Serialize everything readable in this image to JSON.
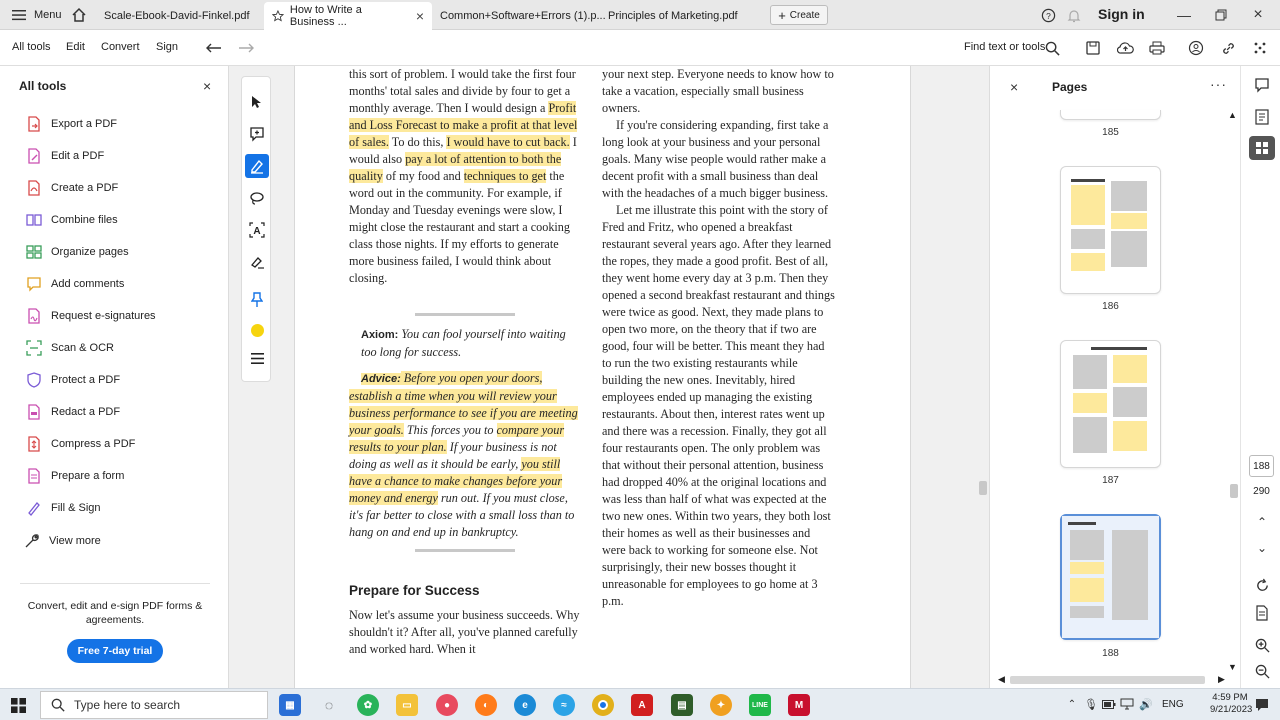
{
  "tabbar": {
    "menu_label": "Menu",
    "tabs": [
      {
        "label": "Scale-Ebook-David-Finkel.pdf"
      },
      {
        "label": "How to Write a Business ...",
        "active": true
      },
      {
        "label": "Common+Software+Errors (1).p..."
      },
      {
        "label": "Principles of Marketing.pdf"
      }
    ],
    "create_label": "Create",
    "signin_label": "Sign in"
  },
  "toolbar": {
    "items": [
      "All tools",
      "Edit",
      "Convert",
      "Sign"
    ],
    "find_label": "Find text or tools"
  },
  "left_panel": {
    "title": "All tools",
    "tools": [
      {
        "label": "Export a PDF",
        "color": "#d84a4a"
      },
      {
        "label": "Edit a PDF",
        "color": "#c94fb0"
      },
      {
        "label": "Create a PDF",
        "color": "#d84a4a"
      },
      {
        "label": "Combine files",
        "color": "#7b5cd6"
      },
      {
        "label": "Organize pages",
        "color": "#3a9e5a"
      },
      {
        "label": "Add comments",
        "color": "#e0a020"
      },
      {
        "label": "Request e-signatures",
        "color": "#c94fb0"
      },
      {
        "label": "Scan & OCR",
        "color": "#3a9e5a"
      },
      {
        "label": "Protect a PDF",
        "color": "#7b5cd6"
      },
      {
        "label": "Redact a PDF",
        "color": "#c94fb0"
      },
      {
        "label": "Compress a PDF",
        "color": "#d84a4a"
      },
      {
        "label": "Prepare a form",
        "color": "#c94fb0"
      },
      {
        "label": "Fill & Sign",
        "color": "#7b5cd6"
      },
      {
        "label": "View more",
        "color": "#333333"
      }
    ],
    "promo_text": "Convert, edit and e-sign PDF forms & agreements.",
    "trial_button": "Free 7-day trial"
  },
  "document": {
    "left_column": {
      "p1": [
        {
          "t": "this sort of problem. I would take the first four months' total sales and divide by four to get a monthly average. Then I would design a ",
          "h": false
        },
        {
          "t": "Profit and Loss Forecast to make a profit at that level of sales.",
          "h": true
        },
        {
          "t": " To do this, ",
          "h": false
        },
        {
          "t": "I would have to cut back.",
          "h": true
        },
        {
          "t": " I would also ",
          "h": false
        },
        {
          "t": "pay a lot of attention to both the quality",
          "h": true
        },
        {
          "t": " of my food and ",
          "h": false
        },
        {
          "t": "techniques to get",
          "h": true
        },
        {
          "t": " the word out in the community. For example, if Monday and Tuesday evenings were slow, I might close the restaurant and start a cooking class those nights. If my efforts to generate more business failed, I would think about closing.",
          "h": false
        }
      ],
      "axiom_label": "Axiom:",
      "axiom_text": " You can fool yourself into waiting too long for success.",
      "advice": [
        {
          "t": "Advice:",
          "h": true,
          "b": true
        },
        {
          "t": " Before you open your doors, establish a time when you will review your business performance to see if you are meeting your goals.",
          "h": true
        },
        {
          "t": " This forces you to ",
          "h": false
        },
        {
          "t": "compare your results to your plan.",
          "h": true
        },
        {
          "t": " If your business is not doing as well as it should be early, ",
          "h": false
        },
        {
          "t": "you still have a chance to make changes before your money and energy",
          "h": true
        },
        {
          "t": " run out. If you must close, it's far better to close with a small loss than to hang on and end up in bankruptcy.",
          "h": false
        }
      ],
      "heading": "Prepare for Success",
      "p_final": "Now let's assume your business succeeds. Why shouldn't it? After all, you've planned carefully and worked hard. When it"
    },
    "right_column": {
      "p1": "your next step. Everyone needs to know how to take a vacation, especially small business owners.",
      "p2": "If you're considering expanding, first take a long look at your business and your personal goals. Many wise people would rather make a decent profit with a small business than deal with the headaches of a much bigger business.",
      "p3": "Let me illustrate this point with the story of Fred and Fritz, who opened a breakfast restaurant several years ago. After they learned the ropes, they made a good profit. Best of all, they went home every day at 3 p.m. Then they opened a second breakfast restaurant and things were twice as good. Next, they made plans to open two more, on the theory that if two are good, four will be better. This meant they had to run the two existing restaurants while building the new ones. Inevitably, hired employees ended up managing the existing restaurants. About then, interest rates went up and there was a recession. Finally, they got all four restaurants open. The only problem was that without their personal attention, business had dropped 40% at the original locations and was less than half of what was expected at the two new ones. Within two years, they both lost their homes as well as their businesses and were back to working for someone else. Not surprisingly, their new bosses thought it unreasonable for employees to go home at 3 p.m."
    }
  },
  "pages_panel": {
    "title": "Pages",
    "thumbs": [
      {
        "num": "185"
      },
      {
        "num": "186"
      },
      {
        "num": "187"
      },
      {
        "num": "188",
        "selected": true
      }
    ]
  },
  "pager": {
    "current": "188",
    "total": "290"
  },
  "taskbar": {
    "search_placeholder": "Type here to search",
    "lang": "ENG",
    "time": "4:59 PM",
    "date": "9/21/2023"
  }
}
